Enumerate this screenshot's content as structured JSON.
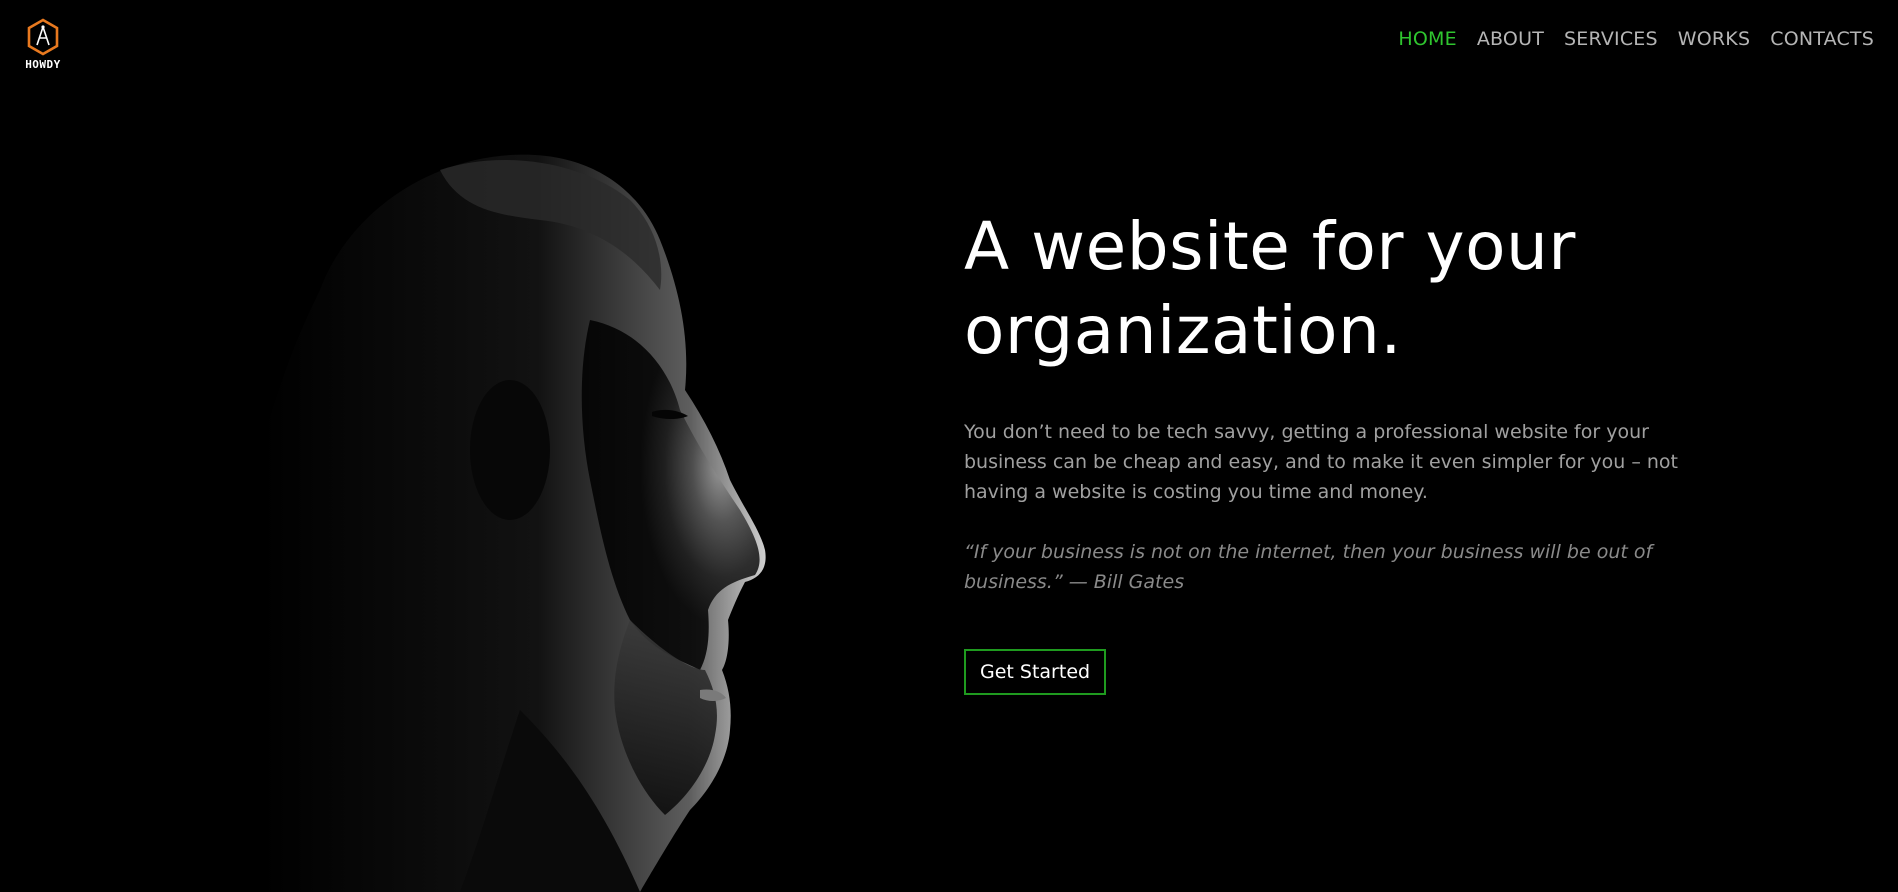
{
  "brand": {
    "logo_text": "HOWDY",
    "logo_color": "#e8791f"
  },
  "nav": {
    "items": [
      {
        "label": "HOME",
        "active": true
      },
      {
        "label": "ABOUT",
        "active": false
      },
      {
        "label": "SERVICES",
        "active": false
      },
      {
        "label": "WORKS",
        "active": false
      },
      {
        "label": "CONTACTS",
        "active": false
      }
    ],
    "active_color": "#2fc52f"
  },
  "hero": {
    "title_line1": "A website for your",
    "title_line2": "organization.",
    "description": "You don’t need to be tech savvy, getting a professional website for your business can be cheap and easy, and to make it even simpler for you – not having a website is costing you time and money.",
    "quote": "“If your business is not on the internet, then your business will be out of business.” — Bill Gates",
    "cta_label": "Get Started",
    "cta_border_color": "#1f9b1f"
  },
  "portrait": {
    "icon": "man-profile-portrait"
  }
}
